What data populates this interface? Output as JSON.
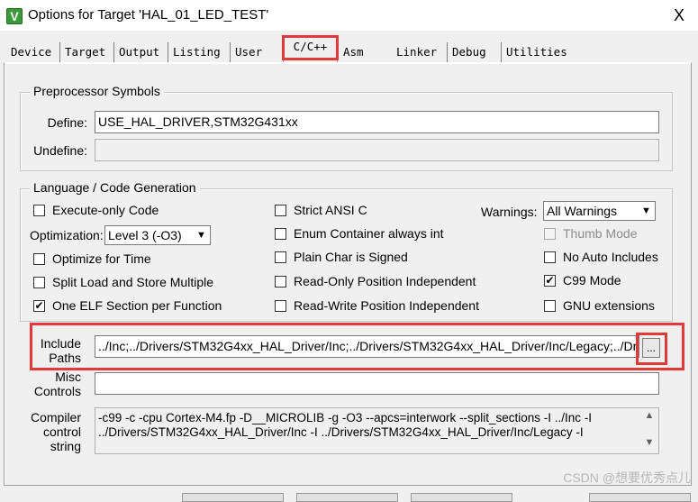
{
  "window": {
    "title": "Options for Target 'HAL_01_LED_TEST'",
    "close_glyph": "X",
    "icon_glyph": "V"
  },
  "tabs": [
    "Device",
    "Target",
    "Output",
    "Listing",
    "User",
    "C/C++",
    "Asm",
    "Linker",
    "Debug",
    "Utilities"
  ],
  "preprocessor": {
    "title": "Preprocessor Symbols",
    "define_label": "Define:",
    "define_value": "USE_HAL_DRIVER,STM32G431xx",
    "undefine_label": "Undefine:",
    "undefine_value": ""
  },
  "language": {
    "title": "Language / Code Generation",
    "execute_only": {
      "label": "Execute-only Code",
      "checked": false
    },
    "optimization_label": "Optimization:",
    "optimization_value": "Level 3 (-O3)",
    "optimize_time": {
      "label": "Optimize for Time",
      "checked": false
    },
    "split_load": {
      "label": "Split Load and Store Multiple",
      "checked": false
    },
    "one_elf": {
      "label": "One ELF Section per Function",
      "checked": true
    },
    "strict_ansi": {
      "label": "Strict ANSI C",
      "checked": false
    },
    "enum_container": {
      "label": "Enum Container always int",
      "checked": false
    },
    "plain_char": {
      "label": "Plain Char is Signed",
      "checked": false
    },
    "readonly_pi": {
      "label": "Read-Only Position Independent",
      "checked": false
    },
    "readwrite_pi": {
      "label": "Read-Write Position Independent",
      "checked": false
    },
    "warnings_label": "Warnings:",
    "warnings_value": "All Warnings",
    "thumb_mode": {
      "label": "Thumb Mode",
      "checked": false,
      "disabled": true
    },
    "no_auto_includes": {
      "label": "No Auto Includes",
      "checked": false
    },
    "c99_mode": {
      "label": "C99 Mode",
      "checked": true
    },
    "gnu_extensions": {
      "label": "GNU extensions",
      "checked": false
    }
  },
  "include": {
    "label_line1": "Include",
    "label_line2": "Paths",
    "value": "../Inc;../Drivers/STM32G4xx_HAL_Driver/Inc;../Drivers/STM32G4xx_HAL_Driver/Inc/Legacy;../Dri",
    "browse_label": "..."
  },
  "misc": {
    "label_line1": "Misc",
    "label_line2": "Controls",
    "value": ""
  },
  "compiler": {
    "label_line1": "Compiler",
    "label_line2": "control",
    "label_line3": "string",
    "line1": "-c99 -c -cpu Cortex-M4.fp -D__MICROLIB -g -O3 --apcs=interwork --split_sections -I ../Inc -I",
    "line2": "../Drivers/STM32G4xx_HAL_Driver/Inc -I ../Drivers/STM32G4xx_HAL_Driver/Inc/Legacy -I"
  },
  "watermark": "CSDN @想要优秀点儿",
  "colors": {
    "highlight": "#e23a3a",
    "dialog_bg": "#f0f0f0",
    "app_icon": "#3a9a3a"
  }
}
